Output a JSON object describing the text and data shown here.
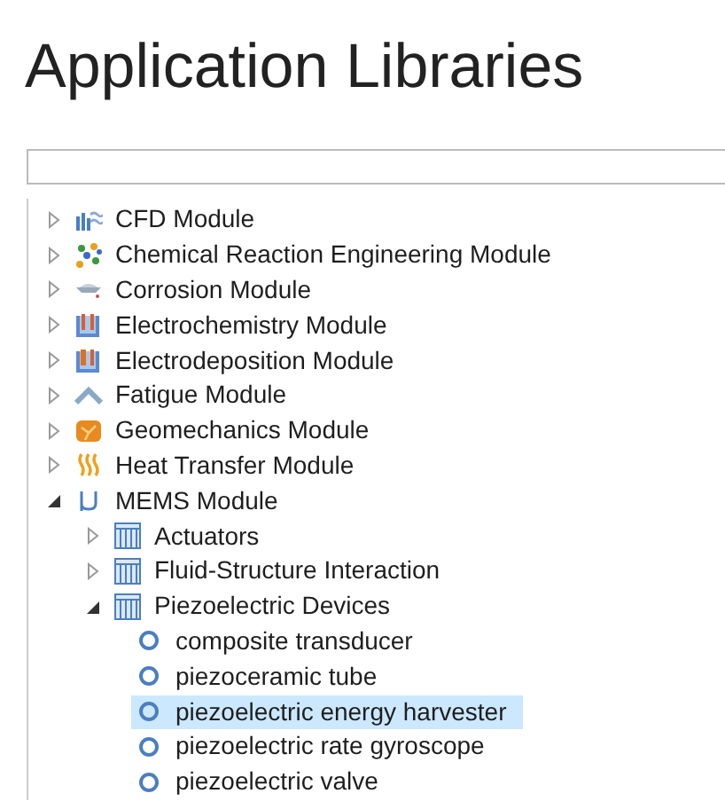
{
  "title": "Application Libraries",
  "tree": [
    {
      "label": "CFD Module",
      "kind": "cfd",
      "expanded": false,
      "selected": false
    },
    {
      "label": "Chemical Reaction Engineering Module",
      "kind": "chemical",
      "expanded": false,
      "selected": false
    },
    {
      "label": "Corrosion Module",
      "kind": "corrosion",
      "expanded": false,
      "selected": false
    },
    {
      "label": "Electrochemistry Module",
      "kind": "electrochem",
      "expanded": false,
      "selected": false
    },
    {
      "label": "Electrodeposition Module",
      "kind": "electrodep",
      "expanded": false,
      "selected": false
    },
    {
      "label": "Fatigue Module",
      "kind": "fatigue",
      "expanded": false,
      "selected": false
    },
    {
      "label": "Geomechanics Module",
      "kind": "geomech",
      "expanded": false,
      "selected": false
    },
    {
      "label": "Heat Transfer Module",
      "kind": "heat",
      "expanded": false,
      "selected": false
    },
    {
      "label": "MEMS Module",
      "kind": "mems",
      "expanded": true,
      "selected": false,
      "children": [
        {
          "label": "Actuators",
          "kind": "folder",
          "expanded": false,
          "selected": false
        },
        {
          "label": "Fluid-Structure Interaction",
          "kind": "folder",
          "expanded": false,
          "selected": false
        },
        {
          "label": "Piezoelectric Devices",
          "kind": "folder",
          "expanded": true,
          "selected": false,
          "children": [
            {
              "label": "composite transducer",
              "kind": "model",
              "selected": false
            },
            {
              "label": "piezoceramic tube",
              "kind": "model",
              "selected": false
            },
            {
              "label": "piezoelectric energy harvester",
              "kind": "model",
              "selected": true
            },
            {
              "label": "piezoelectric rate gyroscope",
              "kind": "model",
              "selected": false
            },
            {
              "label": "piezoelectric valve",
              "kind": "model",
              "selected": false
            }
          ]
        }
      ]
    }
  ]
}
